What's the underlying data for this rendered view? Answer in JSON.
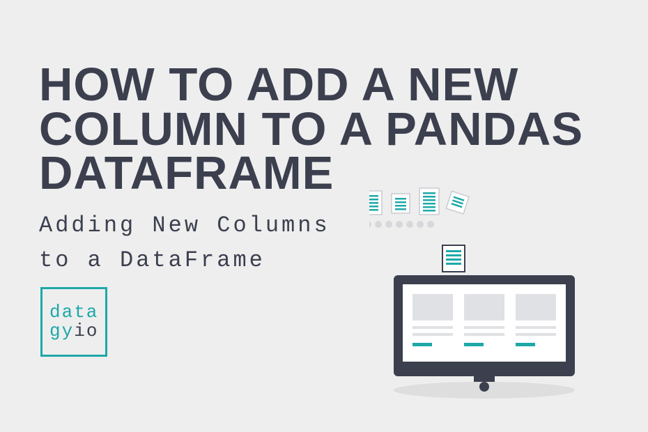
{
  "hero": {
    "title": "HOW TO ADD A NEW COLUMN TO A PANDAS DATAFRAME",
    "subtitle_line1": "Adding New Columns",
    "subtitle_line2": "to a DataFrame"
  },
  "logo": {
    "line1": "data",
    "line2_a": "gy",
    "line2_b": "io"
  },
  "colors": {
    "accent": "#1EA8A8",
    "dark": "#3B3F4E",
    "bg": "#eeeeee"
  }
}
